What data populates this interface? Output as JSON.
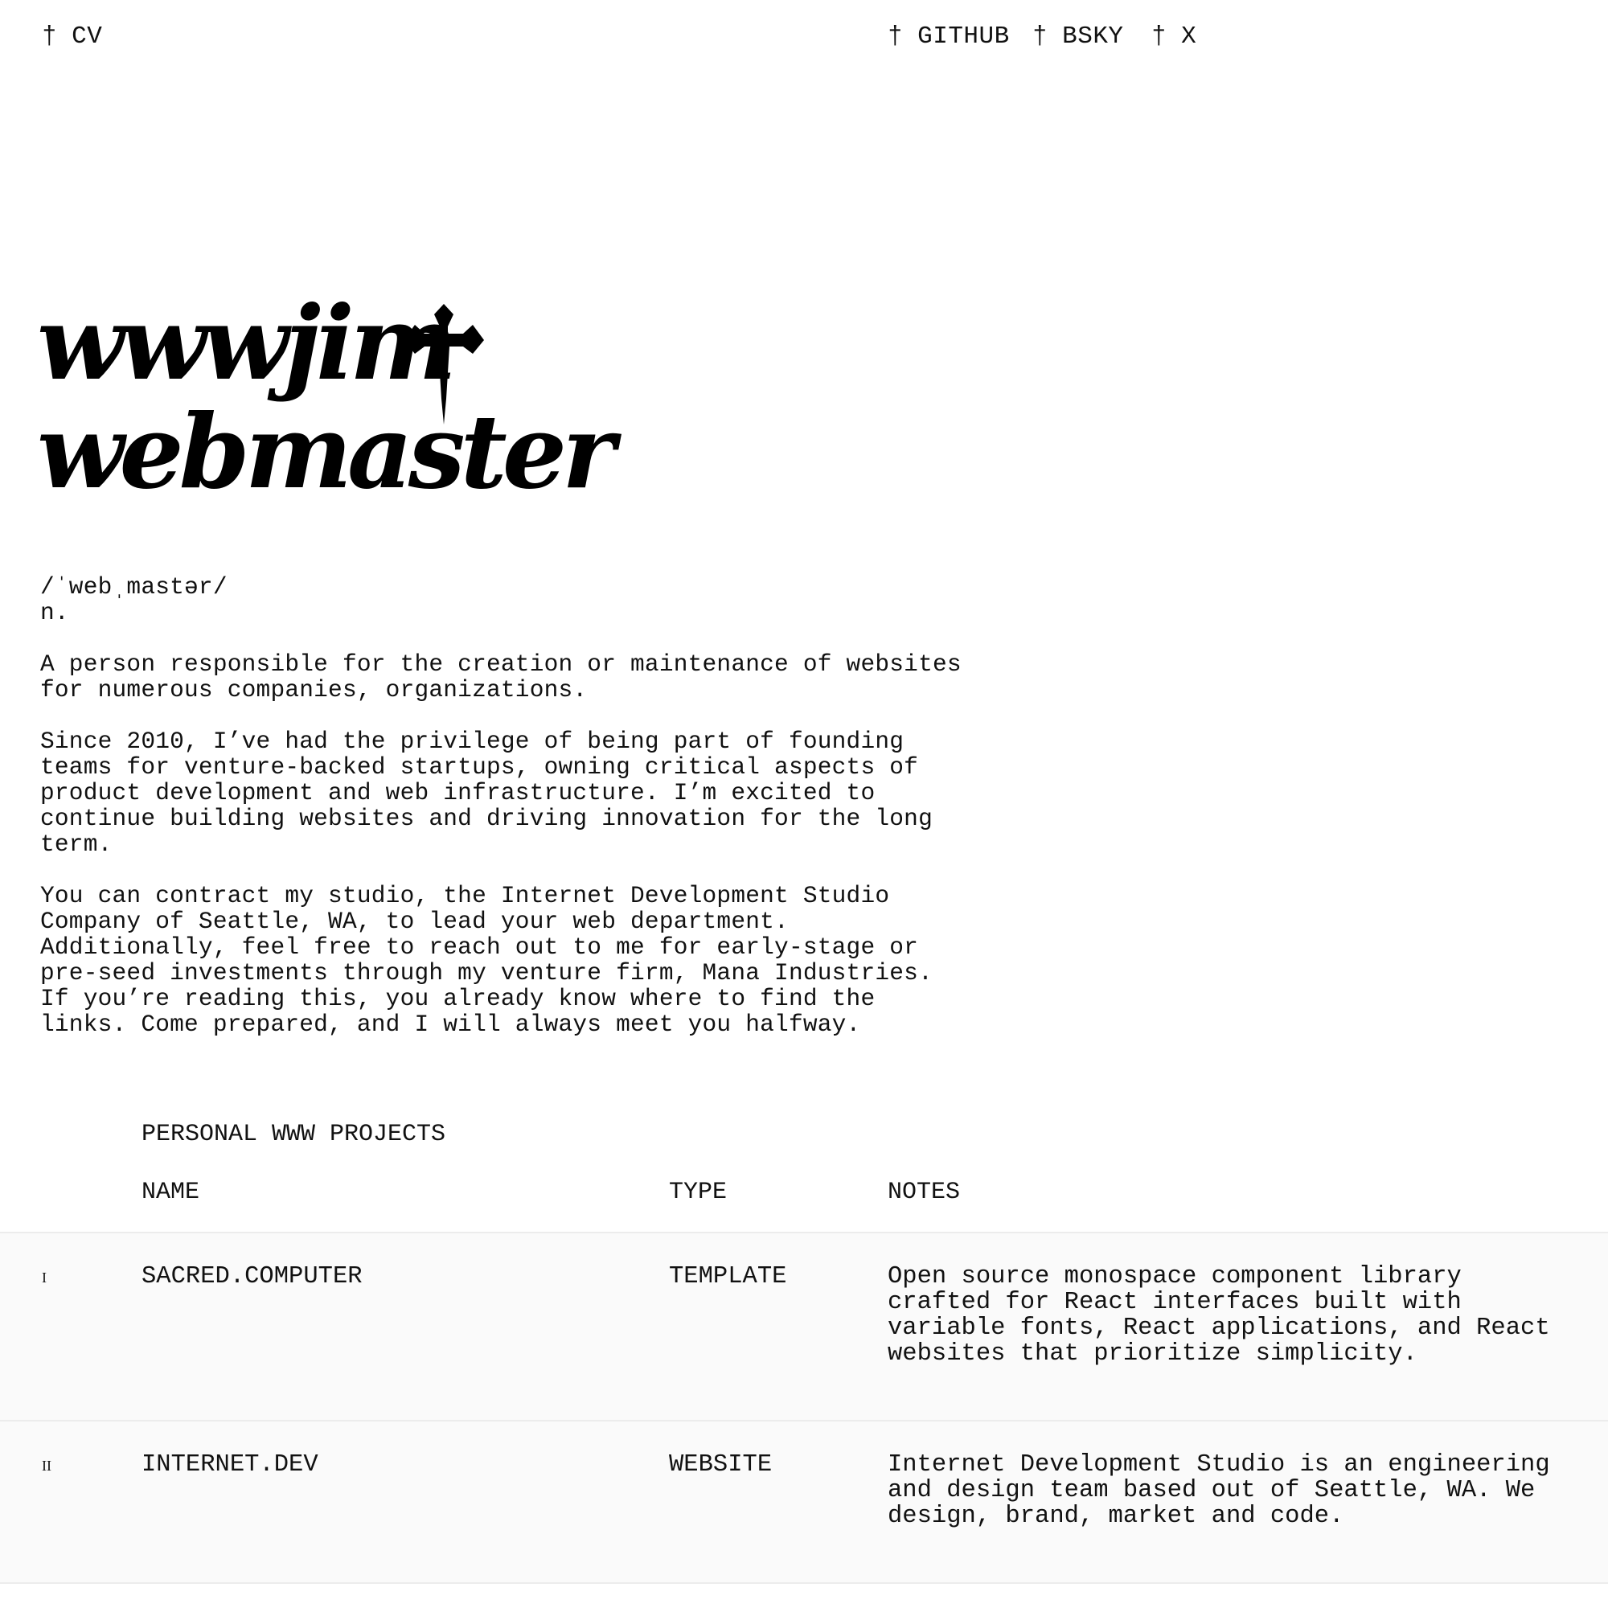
{
  "nav": {
    "dagger": "†",
    "cv": "CV",
    "github": "GITHUB",
    "bsky": "BSKY",
    "x": "X"
  },
  "hero": {
    "line1": "wwwjim",
    "line2": "webmaster"
  },
  "definition": {
    "pronunciation": "/ˈwebˌmastər/",
    "part_of_speech": "n.",
    "meaning": "A person responsible for the creation or maintenance of websites for numerous companies, organizations.",
    "bio": "Since 2010, I’ve had the privilege of being part of founding teams for venture-backed startups, owning critical aspects of product development and web infrastructure. I’m excited to continue building websites and driving innovation for the long term.",
    "contact": "You can contract my studio, the Internet Development Studio Company of Seattle, WA, to lead your web department. Additionally, feel free to reach out to me for early-stage or pre-seed investments through my venture firm, Mana Industries. If you’re reading this, you already know where to find the links. Come prepared, and I will always meet you halfway."
  },
  "projects": {
    "title": "PERSONAL WWW PROJECTS",
    "columns": {
      "name": "NAME",
      "type": "TYPE",
      "notes": "NOTES"
    },
    "rows": [
      {
        "num": "I",
        "name": "SACRED.COMPUTER",
        "type": "TEMPLATE",
        "notes": "Open source monospace component library crafted for React interfaces built with variable fonts, React applications, and React websites that prioritize simplicity."
      },
      {
        "num": "II",
        "name": "INTERNET.DEV",
        "type": "WEBSITE",
        "notes": "Internet Development Studio is an engineering and design team based out of Seattle, WA. We design, brand, market and code."
      }
    ]
  }
}
